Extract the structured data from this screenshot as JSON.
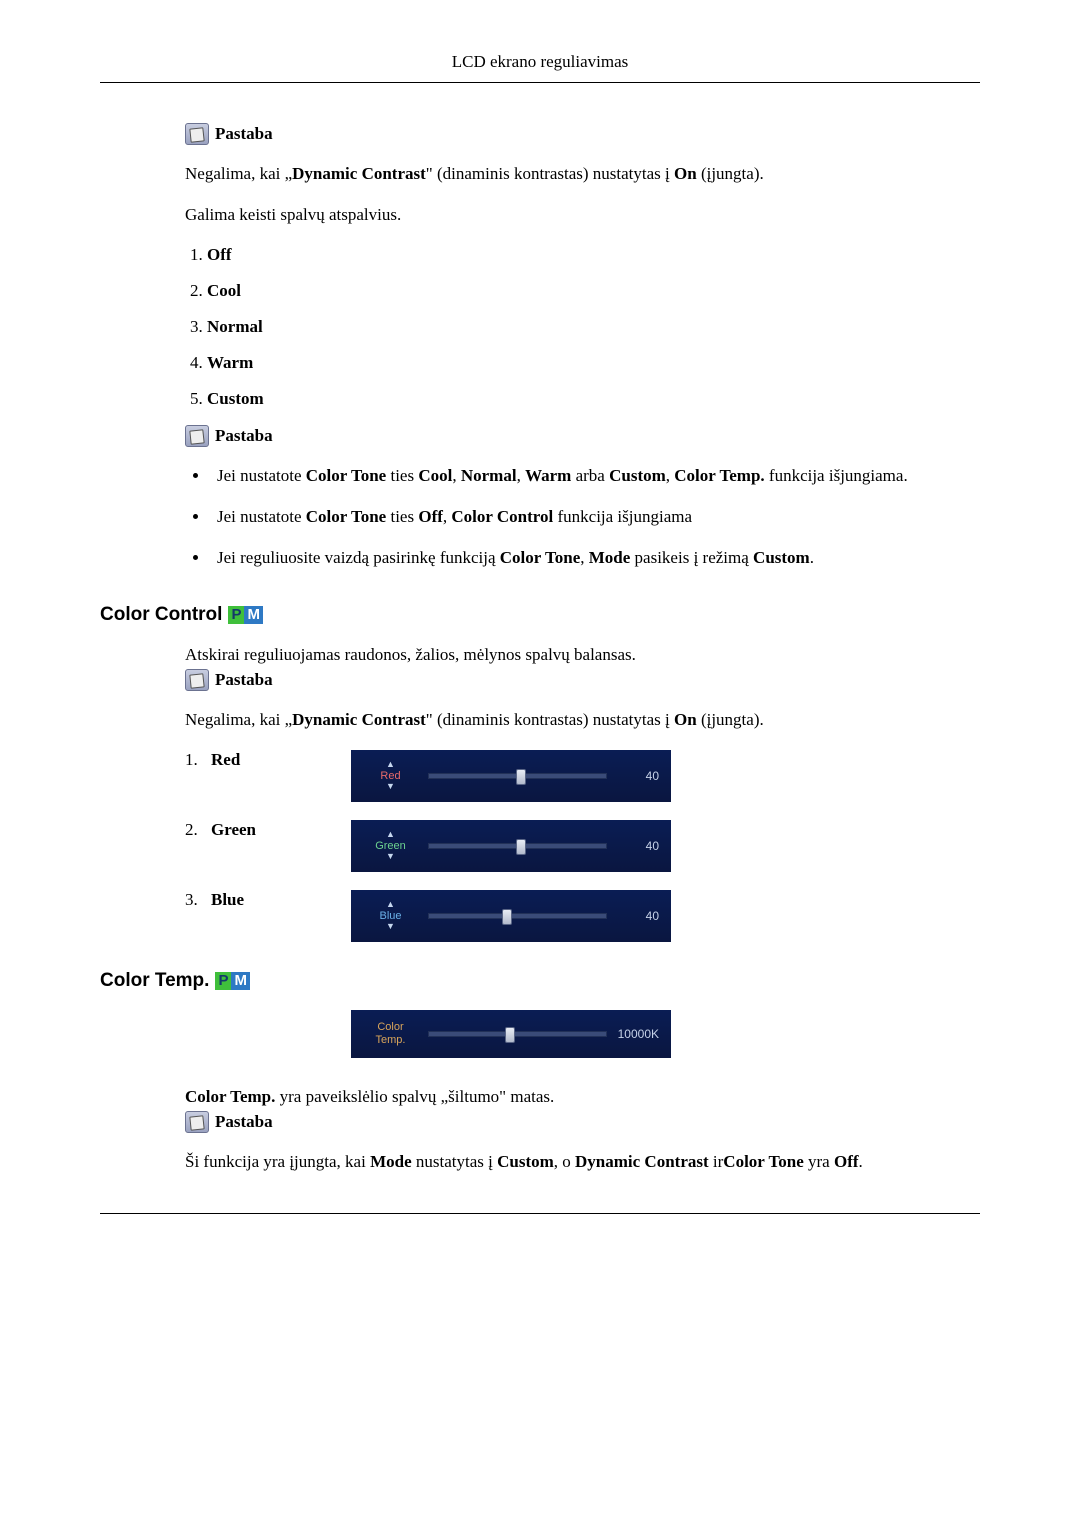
{
  "header": {
    "title": "LCD ekrano reguliavimas"
  },
  "note_label": "Pastaba",
  "section1": {
    "p1": {
      "prefix": "Negalima, kai „",
      "bold1": "Dynamic Contrast",
      "mid": "\" (dinaminis kontrastas) nustatytas į ",
      "bold2": "On",
      "suffix": " (įjungta)."
    },
    "p2": "Galima keisti spalvų atspalvius.",
    "options": [
      "Off",
      "Cool",
      "Normal",
      "Warm",
      "Custom"
    ],
    "bullets": [
      {
        "parts": [
          "Jei nustatote ",
          {
            "b": "Color Tone"
          },
          " ties ",
          {
            "b": "Cool"
          },
          ", ",
          {
            "b": "Normal"
          },
          ", ",
          {
            "b": "Warm"
          },
          " arba ",
          {
            "b": "Custom"
          },
          ", ",
          {
            "b": "Color Temp."
          },
          " funkcija išjungiama."
        ]
      },
      {
        "parts": [
          "Jei nustatote ",
          {
            "b": "Color Tone"
          },
          " ties ",
          {
            "b": "Off"
          },
          ", ",
          {
            "b": "Color Control"
          },
          " funkcija išjungiama"
        ]
      },
      {
        "parts": [
          "Jei reguliuosite vaizdą pasirinkę funkciją ",
          {
            "b": "Color Tone"
          },
          ", ",
          {
            "b": "Mode"
          },
          " pasikeis į režimą ",
          {
            "b": "Custom"
          },
          "."
        ]
      }
    ]
  },
  "color_control": {
    "title": "Color Control",
    "desc": "Atskirai reguliuojamas raudonos, žalios, mėlynos spalvų balansas.",
    "note_p": {
      "prefix": "Negalima, kai „",
      "bold1": "Dynamic Contrast",
      "mid": "\" (dinaminis kontrastas) nustatytas į ",
      "bold2": "On",
      "suffix": " (įjungta)."
    },
    "sliders": [
      {
        "idx": "1.",
        "name": "Red",
        "label": "Red",
        "cls": "lbl-red",
        "value": "40",
        "pos": 49
      },
      {
        "idx": "2.",
        "name": "Green",
        "label": "Green",
        "cls": "lbl-green",
        "value": "40",
        "pos": 49
      },
      {
        "idx": "3.",
        "name": "Blue",
        "label": "Blue",
        "cls": "lbl-blue",
        "value": "40",
        "pos": 41
      }
    ]
  },
  "color_temp": {
    "title": "Color Temp.",
    "slider": {
      "label": "Color Temp.",
      "value": "10000K",
      "pos": 43
    },
    "desc": {
      "bold": "Color Temp.",
      "rest": " yra paveikslėlio spalvų „šiltumo\" matas."
    },
    "note_p": {
      "parts": [
        "Ši funkcija yra įjungta, kai ",
        {
          "b": "Mode"
        },
        " nustatytas į ",
        {
          "b": "Custom"
        },
        ", o ",
        {
          "b": "Dynamic Contrast"
        },
        " ir",
        {
          "b": "Color Tone"
        },
        " yra ",
        {
          "b": "Off"
        },
        "."
      ]
    }
  }
}
